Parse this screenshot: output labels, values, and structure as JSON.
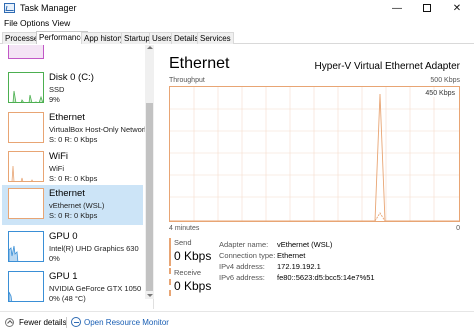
{
  "window": {
    "title": "Task Manager",
    "controls": {
      "minimize": "—",
      "maximize": "",
      "close": "✕"
    }
  },
  "menu": [
    "File",
    "Options",
    "View"
  ],
  "tabs": [
    "Processes",
    "Performance",
    "App history",
    "Startup",
    "Users",
    "Details",
    "Services"
  ],
  "active_tab": "Performance",
  "sidebar": {
    "items": [
      {
        "name": "",
        "subs": [],
        "color": "#c158c6",
        "graph": "empty"
      },
      {
        "name": "Disk 0 (C:)",
        "subs": [
          "SSD",
          "9%"
        ],
        "color": "#4caf50",
        "graph": "disk"
      },
      {
        "name": "Ethernet",
        "subs": [
          "VirtualBox Host-Only Network",
          "S: 0 R: 0 Kbps"
        ],
        "color": "#e8a574",
        "graph": "empty"
      },
      {
        "name": "WiFi",
        "subs": [
          "WiFi",
          "S: 0 R: 0 Kbps"
        ],
        "color": "#e8a574",
        "graph": "wifi"
      },
      {
        "name": "Ethernet",
        "subs": [
          "vEthernet (WSL)",
          "S: 0 R: 0 Kbps"
        ],
        "color": "#e8a574",
        "graph": "empty",
        "selected": true
      },
      {
        "name": "GPU 0",
        "subs": [
          "Intel(R) UHD Graphics 630",
          "0%"
        ],
        "color": "#3a8fd6",
        "graph": "gpu0"
      },
      {
        "name": "GPU 1",
        "subs": [
          "NVIDIA GeForce GTX 1050",
          "0% (48 °C)"
        ],
        "color": "#3a8fd6",
        "graph": "gpu1"
      }
    ]
  },
  "main": {
    "title": "Ethernet",
    "adapter": "Hyper-V Virtual Ethernet Adapter",
    "throughput_label": "Throughput",
    "max_label": "500 Kbps",
    "scale_label": "450 Kbps",
    "axis_left": "4 minutes",
    "axis_right": "0",
    "send_label": "Send",
    "send_value": "0 Kbps",
    "receive_label": "Receive",
    "receive_value": "0 Kbps",
    "properties": [
      {
        "key": "Adapter name:",
        "value": "vEthernet (WSL)"
      },
      {
        "key": "Connection type:",
        "value": "Ethernet"
      },
      {
        "key": "IPv4 address:",
        "value": "172.19.192.1"
      },
      {
        "key": "IPv6 address:",
        "value": "fe80::5623:d5:bcc5:14e7%51"
      }
    ]
  },
  "footer": {
    "fewer_details": "Fewer details",
    "open_monitor": "Open Resource Monitor"
  },
  "colors": {
    "network": "#e8a574",
    "selected": "#cce4f7",
    "link": "#1a5fb4"
  }
}
